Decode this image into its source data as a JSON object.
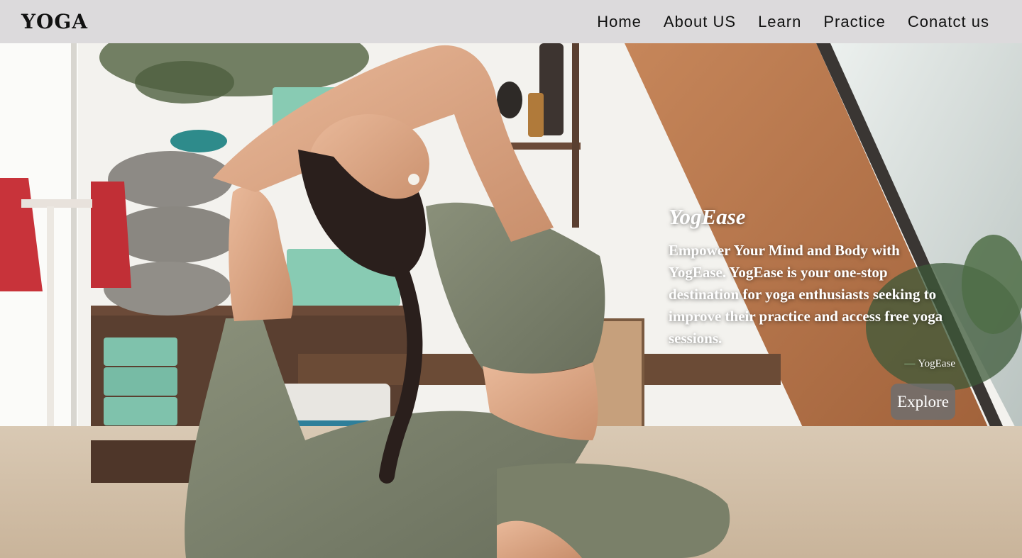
{
  "header": {
    "logo": "YOGA",
    "nav": [
      {
        "label": "Home"
      },
      {
        "label": "About US"
      },
      {
        "label": "Learn"
      },
      {
        "label": "Practice"
      },
      {
        "label": "Conatct us"
      }
    ]
  },
  "hero": {
    "title": "YogEase",
    "body": "Empower Your Mind and Body with YogEase. YogEase is your one-stop destination for yoga enthusiasts seeking to improve their practice and access free yoga sessions.",
    "cite_dash": "—",
    "cite": "YogEase",
    "explore_label": "Explore"
  },
  "colors": {
    "navbar_bg": "#dcdadc",
    "text_dark": "#111111",
    "outfit_green": "#7d846c",
    "wood": "#b9784a"
  }
}
